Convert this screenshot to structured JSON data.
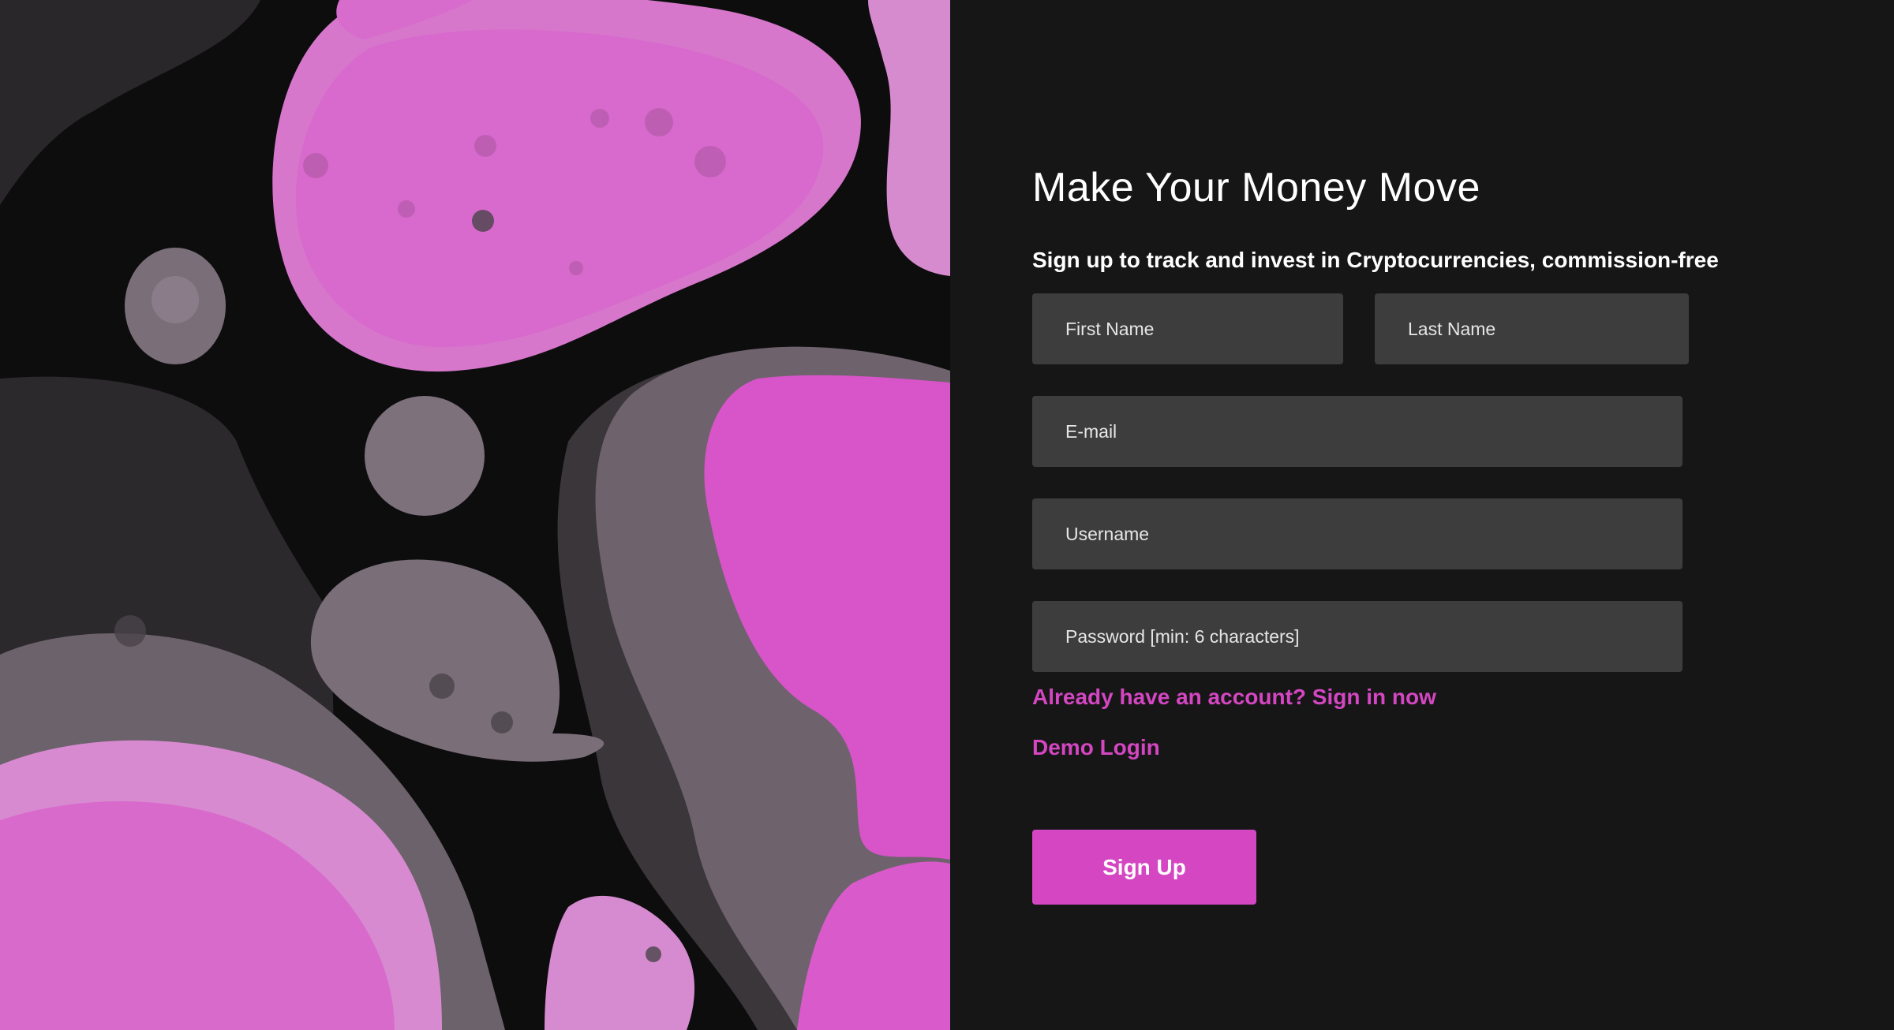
{
  "signup": {
    "title": "Make Your Money Move",
    "subtitle": "Sign up to track and invest in Cryptocurrencies, commission-free",
    "fields": {
      "first_name_placeholder": "First Name",
      "last_name_placeholder": "Last Name",
      "email_placeholder": "E-mail",
      "username_placeholder": "Username",
      "password_placeholder": "Password [min: 6 characters]"
    },
    "signin_link": "Already have an account? Sign in now",
    "demo_link": "Demo Login",
    "submit_label": "Sign Up"
  },
  "colors": {
    "background": "#171617",
    "input_background": "#3e3d3e",
    "accent": "#d446c2",
    "text": "#ffffff"
  },
  "artwork": {
    "description_icon": "abstract-fluid-art"
  }
}
